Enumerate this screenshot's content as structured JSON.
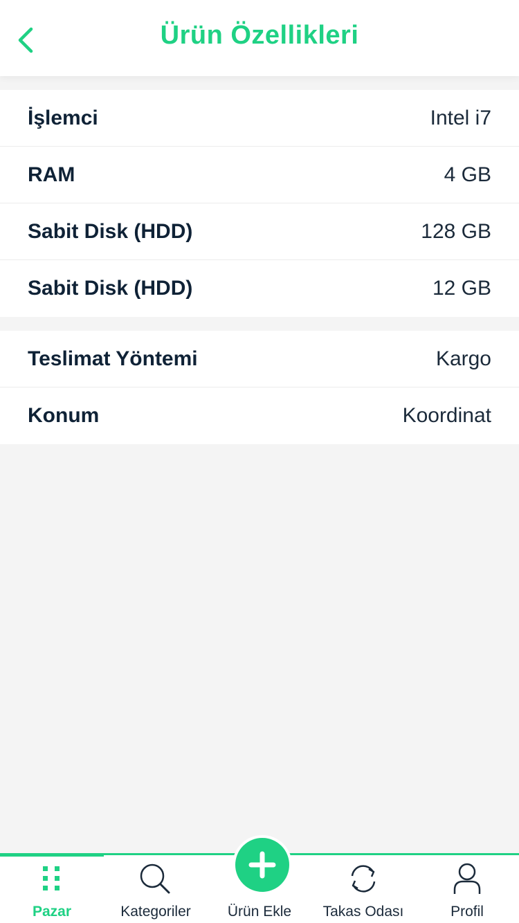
{
  "header": {
    "title": "Ürün Özellikleri",
    "back_icon": "chevron-left-icon"
  },
  "specs": [
    {
      "label": "İşlemci",
      "value": "Intel i7"
    },
    {
      "label": "RAM",
      "value": "4 GB"
    },
    {
      "label": "Sabit Disk (HDD)",
      "value": "128 GB"
    },
    {
      "label": "Sabit Disk (HDD)",
      "value": "12 GB"
    }
  ],
  "delivery": [
    {
      "label": "Teslimat Yöntemi",
      "value": "Kargo"
    },
    {
      "label": "Konum",
      "value": "Koordinat"
    }
  ],
  "tabbar": {
    "tabs": [
      {
        "label": "Pazar",
        "icon": "grid-dots-icon",
        "active": true
      },
      {
        "label": "Kategoriler",
        "icon": "search-icon",
        "active": false
      },
      {
        "label": "Ürün Ekle",
        "icon": "plus-icon",
        "active": false
      },
      {
        "label": "Takas Odası",
        "icon": "refresh-icon",
        "active": false
      },
      {
        "label": "Profil",
        "icon": "user-icon",
        "active": false
      }
    ]
  },
  "colors": {
    "accent": "#1fd184",
    "text_dark": "#0f2236",
    "background": "#f4f4f4"
  }
}
